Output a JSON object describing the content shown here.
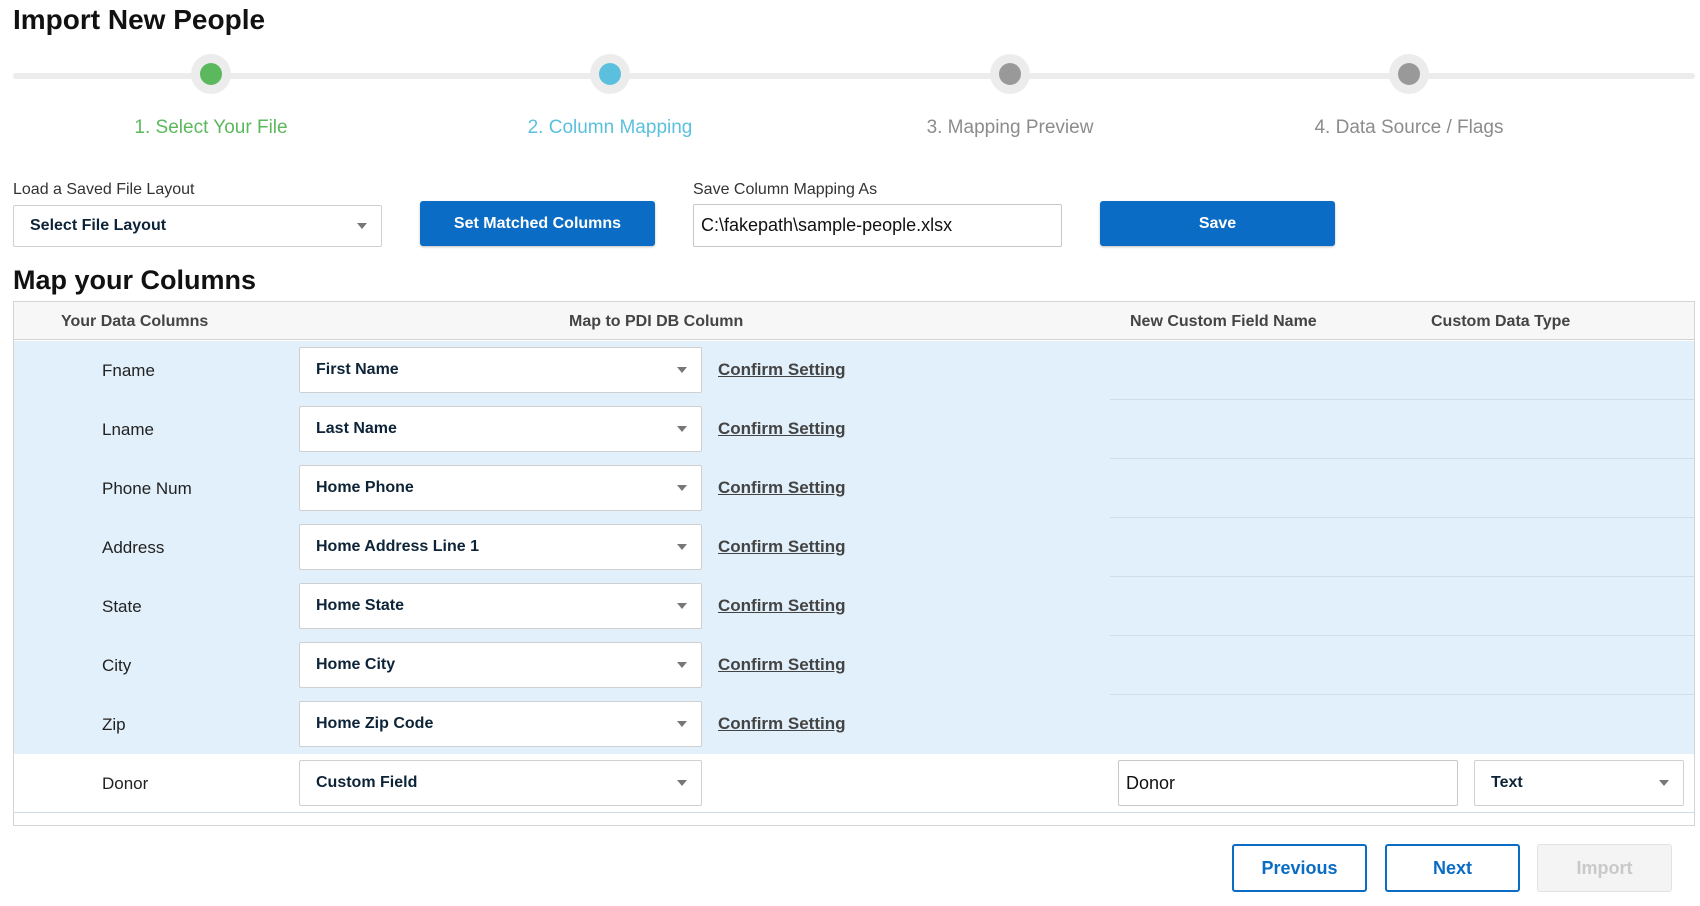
{
  "page": {
    "title": "Import New People"
  },
  "stepper": {
    "steps": [
      {
        "label": "1. Select Your File",
        "state": "done"
      },
      {
        "label": "2. Column Mapping",
        "state": "active"
      },
      {
        "label": "3. Mapping Preview",
        "state": "todo"
      },
      {
        "label": "4. Data Source / Flags",
        "state": "todo"
      }
    ]
  },
  "toolbar": {
    "layout_label": "Load a Saved File Layout",
    "layout_select": "Select File Layout",
    "set_matched_label": "Set Matched Columns",
    "save_as_label": "Save Column Mapping As",
    "save_as_value": "C:\\fakepath\\sample-people.xlsx",
    "save_label": "Save"
  },
  "mapping": {
    "title": "Map your Columns",
    "headers": {
      "data_columns": "Your Data Columns",
      "db_column": "Map to PDI DB Column",
      "custom_name": "New Custom Field Name",
      "custom_type": "Custom Data Type"
    },
    "confirm_label": "Confirm Setting",
    "rows": [
      {
        "source": "Fname",
        "target": "First Name"
      },
      {
        "source": "Lname",
        "target": "Last Name"
      },
      {
        "source": "Phone Num",
        "target": "Home Phone"
      },
      {
        "source": "Address",
        "target": "Home Address Line 1"
      },
      {
        "source": "State",
        "target": "Home State"
      },
      {
        "source": "City",
        "target": "Home City"
      },
      {
        "source": "Zip",
        "target": "Home Zip Code"
      },
      {
        "source": "Donor",
        "target": "Custom Field",
        "custom_name": "Donor",
        "custom_type": "Text"
      }
    ]
  },
  "footer": {
    "previous_label": "Previous",
    "next_label": "Next",
    "import_label": "Import"
  },
  "colors": {
    "primary": "#0a6cc4",
    "step_done": "#5cb85c",
    "step_active": "#5bc0de",
    "step_todo": "#999999",
    "mapped_row_bg": "#e2f0fb"
  }
}
